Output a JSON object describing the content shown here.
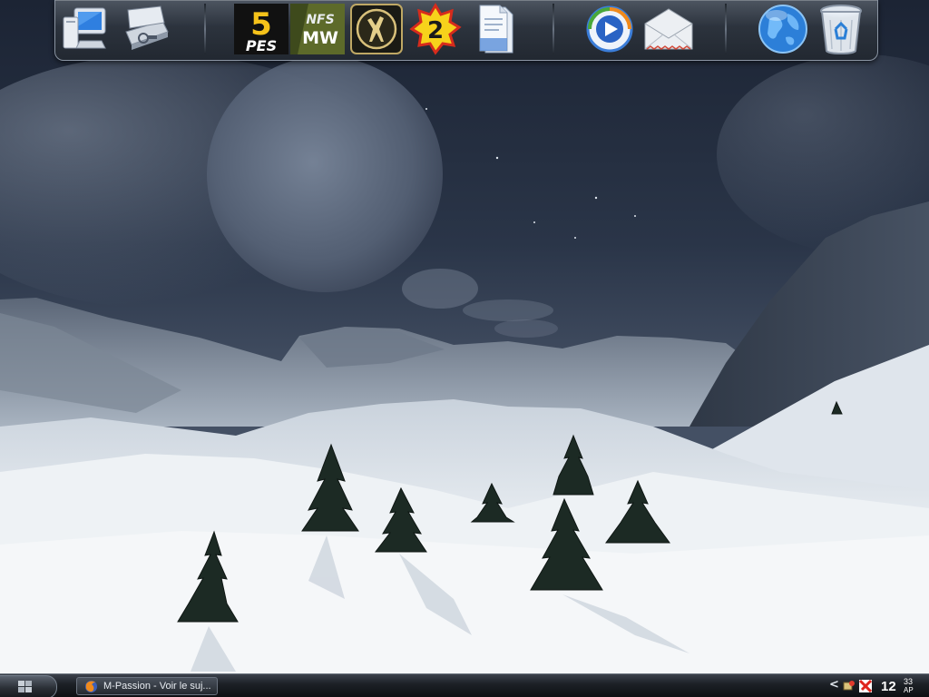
{
  "dock": {
    "items": [
      {
        "id": "my-computer",
        "icon": "computer-icon"
      },
      {
        "id": "scanner",
        "icon": "scanner-icon"
      },
      {
        "id": "pes5",
        "icon": "pes5-game-icon",
        "line1": "5",
        "line2": "PES"
      },
      {
        "id": "nfs-mw",
        "icon": "nfs-most-wanted-game-icon",
        "line1": "NFS",
        "line2": "MW"
      },
      {
        "id": "game-emblem",
        "icon": "deer-emblem-game-icon"
      },
      {
        "id": "game-2",
        "icon": "badge-2-game-icon",
        "label": "2"
      },
      {
        "id": "documents",
        "icon": "documents-icon"
      },
      {
        "id": "media-player",
        "icon": "media-player-icon"
      },
      {
        "id": "mail",
        "icon": "mail-envelope-icon"
      },
      {
        "id": "browser",
        "icon": "globe-icon"
      },
      {
        "id": "recycle-bin",
        "icon": "recycle-bin-icon"
      }
    ]
  },
  "taskbar": {
    "start_icon": "start-orb-icon",
    "task": {
      "label": "M-Passion - Voir le suj...",
      "icon": "firefox-icon"
    },
    "tray": {
      "chevron": "<",
      "icons": [
        "network-alert-icon",
        "antivirus-icon"
      ],
      "clock": {
        "hm": "12",
        "sec": "33",
        "ampm": "AP"
      }
    }
  },
  "colors": {
    "sky": "#1b2638",
    "snow": "#e9eef3",
    "dock": "#2c333d",
    "taskbar": "#1d2127"
  }
}
